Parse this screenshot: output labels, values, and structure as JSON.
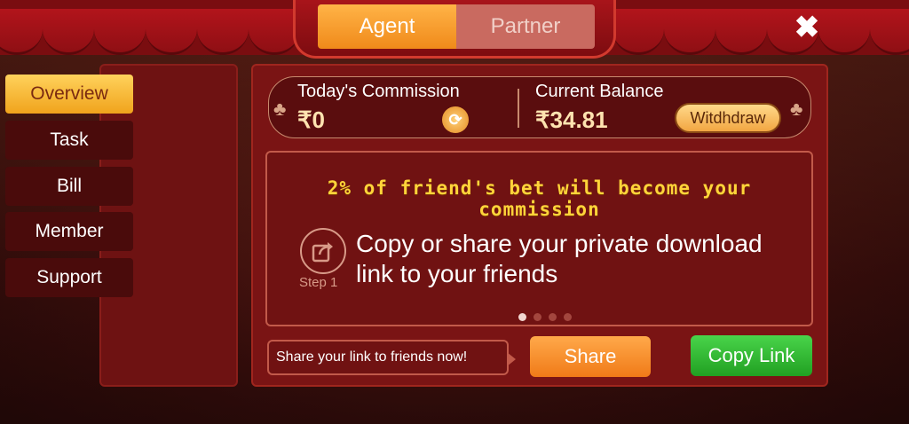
{
  "tabs": {
    "agent": "Agent",
    "partner": "Partner",
    "active": "Agent"
  },
  "close_glyph": "✖",
  "sidebar": {
    "items": [
      {
        "label": "Overview",
        "active": true
      },
      {
        "label": "Task",
        "active": false
      },
      {
        "label": "Bill",
        "active": false
      },
      {
        "label": "Member",
        "active": false
      },
      {
        "label": "Support",
        "active": false
      }
    ]
  },
  "stats": {
    "commission_title": "Today's Commission",
    "commission_value": "₹0",
    "balance_title": "Current Balance",
    "balance_value": "₹34.81",
    "withdraw_label": "Witdhdraw"
  },
  "promo": {
    "headline": "2% of friend's bet will become your commission",
    "step_label": "Step 1",
    "step_text": "Copy or share your private download link to your friends",
    "carousel_pages": 4,
    "carousel_active": 1
  },
  "actions": {
    "share_hint": "Share your link to friends now!",
    "share_label": "Share",
    "copy_label": "Copy Link"
  },
  "colors": {
    "accent_orange": "#f08a1a",
    "accent_green": "#21a022",
    "gold_text": "#ffd43a",
    "panel_red": "#7a1414"
  },
  "icons": {
    "club": "♣",
    "refresh": "⟳",
    "share": "share-arrow-icon"
  }
}
